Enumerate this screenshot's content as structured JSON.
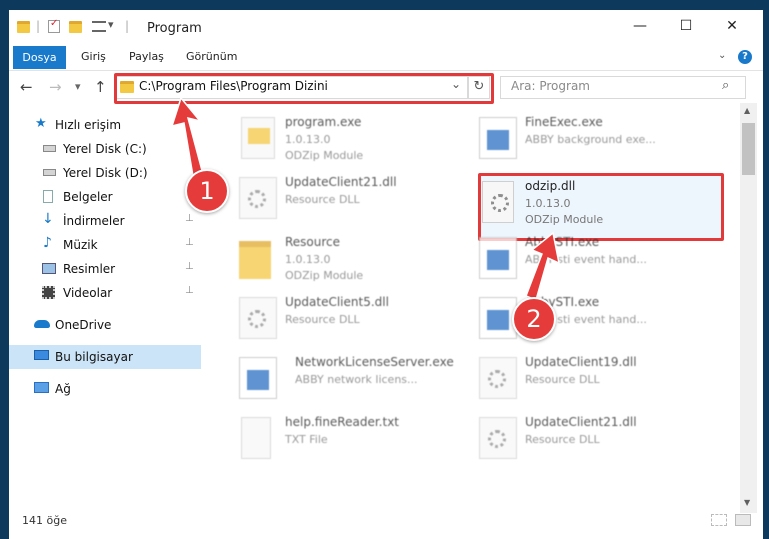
{
  "window": {
    "title": "Program",
    "minimize": "—",
    "maximize": "☐",
    "close": "✕"
  },
  "ribbon": {
    "tabs": [
      "Dosya",
      "Giriş",
      "Paylaş",
      "Görünüm"
    ],
    "help": "?"
  },
  "address": {
    "path": "C:\\Program Files\\Program Dizini",
    "back": "←",
    "forward": "→",
    "recent": "▾",
    "up": "↑",
    "dropdown": "⌄",
    "refresh": "↻"
  },
  "search": {
    "placeholder": "Ara: Program",
    "icon": "⌕"
  },
  "nav": {
    "items": [
      {
        "label": "Hızlı erişim",
        "icon": "star-icon"
      },
      {
        "label": "Yerel Disk (C:)",
        "icon": "drive-icon",
        "pin": "📌"
      },
      {
        "label": "Yerel Disk (D:)",
        "icon": "drive-icon",
        "pin": "📌"
      },
      {
        "label": "Belgeler",
        "icon": "documents-icon",
        "pin": "📌"
      },
      {
        "label": "İndirmeler",
        "icon": "download-icon",
        "pin": "📌"
      },
      {
        "label": "Müzik",
        "icon": "music-icon",
        "pin": "📌"
      },
      {
        "label": "Resimler",
        "icon": "pictures-icon",
        "pin": "📌"
      },
      {
        "label": "Videolar",
        "icon": "videos-icon",
        "pin": "📌"
      },
      {
        "label": "OneDrive",
        "icon": "cloud-icon"
      },
      {
        "label": "Bu bilgisayar",
        "icon": "computer-icon"
      },
      {
        "label": "Ağ",
        "icon": "network-icon"
      }
    ]
  },
  "files": [
    {
      "name": "program.exe",
      "line2": "1.0.13.0",
      "line3": "ODZip Module",
      "type": "program"
    },
    {
      "name": "FineExec.exe",
      "line2": "ABBY background exe...",
      "line3": "",
      "type": "exe"
    },
    {
      "name": "UpdateClient21.dll",
      "line2": "Resource DLL",
      "line3": "",
      "type": "dll"
    },
    {
      "name": "odzip.dll",
      "line2": "1.0.13.0",
      "line3": "ODZip Module",
      "type": "dll"
    },
    {
      "name": "Resource",
      "line2": "1.0.13.0",
      "line3": "ODZip Module",
      "type": "folder"
    },
    {
      "name": "AbbySTI.exe",
      "line2": "ABBY sti event hand...",
      "line3": "",
      "type": "exe"
    },
    {
      "name": "UpdateClient5.dll",
      "line2": "Resource DLL",
      "line3": "",
      "type": "dll"
    },
    {
      "name": "AbbySTI.exe",
      "line2": "ABBY sti event hand...",
      "line3": "",
      "type": "exe"
    },
    {
      "name": "NetworkLicenseServer.exe",
      "line2": "ABBY network licens...",
      "line3": "",
      "type": "exe"
    },
    {
      "name": "UpdateClient19.dll",
      "line2": "Resource DLL",
      "line3": "",
      "type": "dll"
    },
    {
      "name": "help.fineReader.txt",
      "line2": "TXT File",
      "line3": "",
      "type": "txt"
    },
    {
      "name": "UpdateClient21.dll",
      "line2": "Resource DLL",
      "line3": "",
      "type": "dll"
    }
  ],
  "status": {
    "count": "141 öğe"
  },
  "callouts": {
    "one": "1",
    "two": "2"
  },
  "colors": {
    "accent": "#1979ca",
    "highlight": "#e23a3a",
    "selection": "#cce4f7"
  }
}
